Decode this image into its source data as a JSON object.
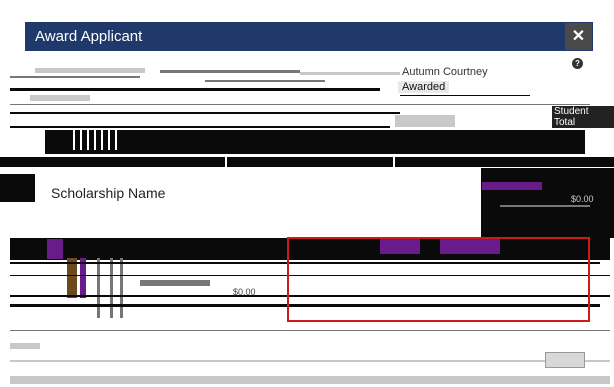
{
  "dialog": {
    "title": "Award Applicant",
    "close_glyph": "✕"
  },
  "applicant": {
    "name_echo": "Autumn Courtney",
    "status_label": "Awarded",
    "student_total_label": "Student Total"
  },
  "scholarship": {
    "name_label": "Scholarship Name"
  },
  "award": {
    "amount": "$0.00",
    "summary_amount": "$0.00"
  },
  "footer": {
    "action_label": ""
  },
  "icons": {
    "help": "help-icon",
    "close": "close-icon"
  },
  "colors": {
    "titlebar": "#1f3a6a",
    "close_button": "#4a4a4a",
    "highlight": "#cc1b1b"
  }
}
